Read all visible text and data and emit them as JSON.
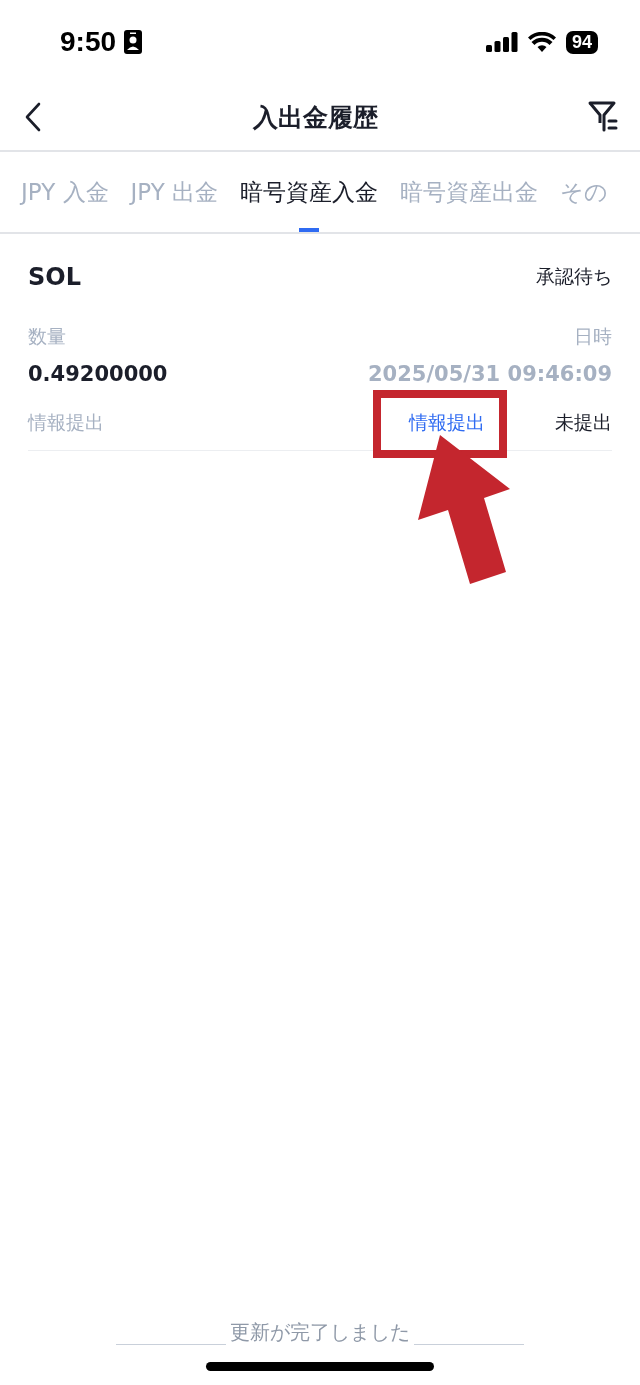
{
  "status_bar": {
    "time": "9:50",
    "battery": "94"
  },
  "nav": {
    "title": "入出金履歴"
  },
  "tabs": [
    {
      "label": "JPY 入金",
      "selected": false
    },
    {
      "label": "JPY 出金",
      "selected": false
    },
    {
      "label": "暗号資産入金",
      "selected": true
    },
    {
      "label": "暗号資産出金",
      "selected": false
    },
    {
      "label": "その",
      "selected": false
    }
  ],
  "records": [
    {
      "asset": "SOL",
      "status": "承認待ち",
      "amount_label": "数量",
      "amount": "0.49200000",
      "date_label": "日時",
      "date": "2025/05/31 09:46:09",
      "info_label": "情報提出",
      "info_link": "情報提出",
      "info_status": "未提出"
    }
  ],
  "toast": "更新が完了しました"
}
